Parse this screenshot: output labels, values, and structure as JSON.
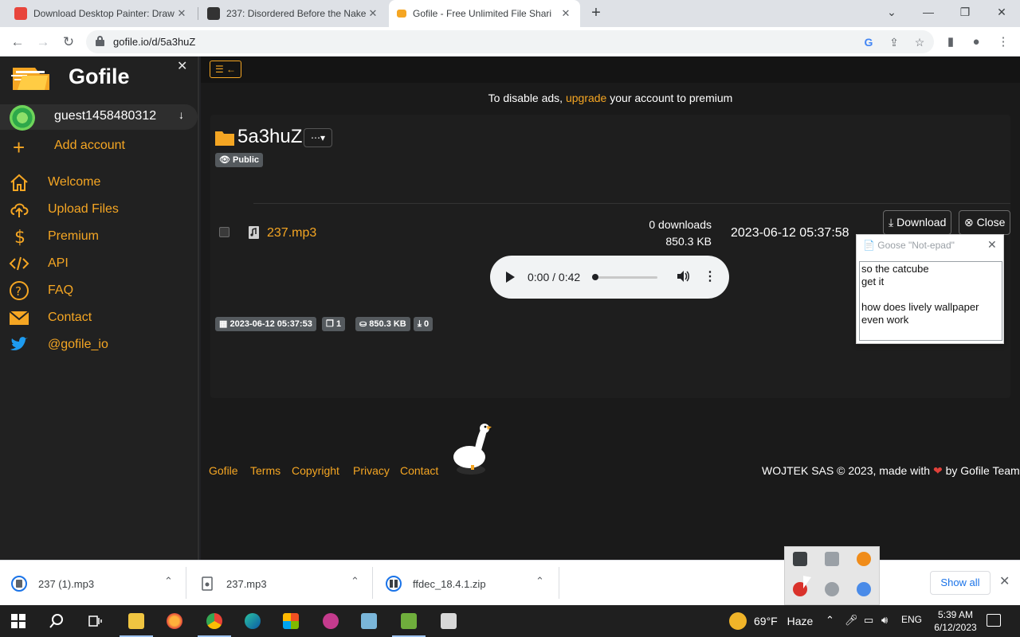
{
  "browser": {
    "tabs": [
      {
        "title": "Download Desktop Painter: Draw",
        "favicon_color": "#e8453c"
      },
      {
        "title": "237: Disordered Before the Nake",
        "favicon_color": "#333333"
      },
      {
        "title": "Gofile - Free Unlimited File Shari",
        "favicon_color": "#f5a623"
      }
    ],
    "url": "gofile.io/d/5a3huZ"
  },
  "sidebar": {
    "brand": "Gofile",
    "username": "guest1458480312",
    "add_account": "Add account",
    "nav": [
      {
        "label": "Welcome",
        "icon": "home-icon"
      },
      {
        "label": "Upload Files",
        "icon": "cloud-upload-icon"
      },
      {
        "label": "Premium",
        "icon": "dollar-icon"
      },
      {
        "label": "API",
        "icon": "code-icon"
      },
      {
        "label": "FAQ",
        "icon": "question-icon"
      },
      {
        "label": "Contact",
        "icon": "envelope-icon"
      },
      {
        "label": "@gofile_io",
        "icon": "twitter-icon"
      }
    ]
  },
  "main": {
    "ad_note": {
      "before": "To disable ads,",
      "link": "upgrade",
      "after": "your account to premium"
    },
    "folder": {
      "name": "5a3huZ",
      "visibility": "Public",
      "created": "2023-06-12 05:37:53",
      "file_count": "1",
      "total_size": "850.3 KB",
      "downloads": "0"
    },
    "file": {
      "name": "237.mp3",
      "downloads": "0 downloads",
      "size": "850.3 KB",
      "date": "2023-06-12 05:37:58",
      "download_label": "Download",
      "close_label": "Close",
      "player_time": "0:00 / 0:42"
    },
    "footer": {
      "links": [
        "Gofile",
        "Terms",
        "Copyright",
        "Privacy",
        "Contact"
      ],
      "right_before": "WOJTEK SAS © 2023, made with",
      "right_after": "by Gofile Team"
    }
  },
  "goose_note": {
    "title": "Goose \"Not-epad\"",
    "lines": [
      "so the catcube",
      "get it",
      "",
      "how does lively wallpaper",
      "even work"
    ]
  },
  "downloads_shelf": {
    "items": [
      "237 (1).mp3",
      "237.mp3",
      "ffdec_18.4.1.zip"
    ],
    "show_all": "Show all"
  },
  "taskbar": {
    "weather_temp": "69°F",
    "weather_desc": "Haze",
    "language": "ENG",
    "time": "5:39 AM",
    "date": "6/12/2023"
  },
  "colors": {
    "accent": "#f5a623",
    "sidebar_bg": "#212121",
    "main_bg": "#1a1a1a"
  }
}
